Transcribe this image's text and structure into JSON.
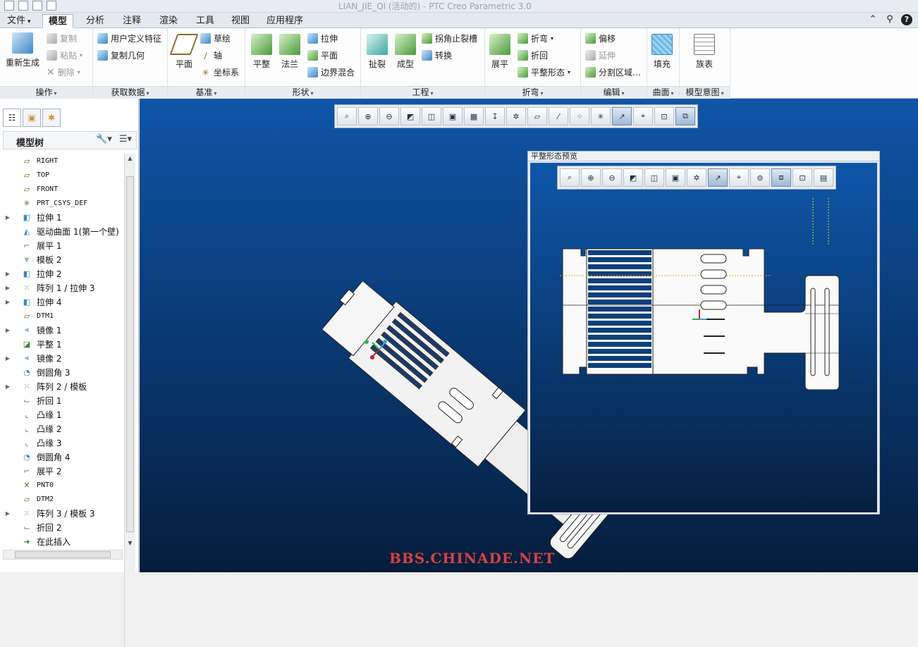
{
  "window": {
    "title": "LIAN_JIE_QI (活动的) - PTC Creo Parametric 3.0"
  },
  "tabs": [
    {
      "label": "文件",
      "dropdown": "▾"
    },
    {
      "label": "模型"
    },
    {
      "label": "分析"
    },
    {
      "label": "注释"
    },
    {
      "label": "渲染"
    },
    {
      "label": "工具"
    },
    {
      "label": "视图"
    },
    {
      "label": "应用程序"
    }
  ],
  "ribbon": {
    "ops": {
      "label": "操作",
      "regen": "重新生成",
      "copy": "复制",
      "paste": "粘贴",
      "delete": "删除"
    },
    "getdata": {
      "label": "获取数据",
      "udf": "用户定义特征",
      "copygeom": "复制几何"
    },
    "datum": {
      "label": "基准",
      "plane": "平面",
      "sketch": "草绘",
      "axis": "轴",
      "csys": "坐标系"
    },
    "shapes": {
      "label": "形状",
      "flat": "平整",
      "flange": "法兰",
      "extrude": "拉伸",
      "plane": "平面",
      "blend": "边界混合"
    },
    "eng": {
      "label": "工程",
      "rip": "扯裂",
      "form": "成型",
      "corner": "拐角止裂槽",
      "convert": "转换"
    },
    "bend": {
      "label": "折弯",
      "unfold": "展平",
      "bend": "折弯",
      "bendback": "折回",
      "flatstate": "平整形态"
    },
    "edit": {
      "label": "编辑",
      "offset": "偏移",
      "extend": "延伸",
      "split": "分割区域…"
    },
    "surface": {
      "label": "曲面",
      "fill": "填充"
    },
    "intent": {
      "label": "模型意图",
      "family": "族表"
    }
  },
  "model_tree": {
    "title": "模型树",
    "items": [
      {
        "label": "RIGHT",
        "icon": "datum-plane-icon",
        "expand": false,
        "mono": true
      },
      {
        "label": "TOP",
        "icon": "datum-plane-icon",
        "expand": false,
        "mono": true
      },
      {
        "label": "FRONT",
        "icon": "datum-plane-icon",
        "expand": false,
        "mono": true
      },
      {
        "label": "PRT_CSYS_DEF",
        "icon": "csys-icon",
        "expand": false,
        "mono": true
      },
      {
        "label": "拉伸 1",
        "icon": "extrude-icon",
        "expand": true
      },
      {
        "label": "驱动曲面 1(第一个壁)",
        "icon": "surface-icon",
        "expand": false
      },
      {
        "label": "展平 1",
        "icon": "unfold-icon",
        "expand": false
      },
      {
        "label": "模板 2",
        "icon": "form-icon",
        "expand": false
      },
      {
        "label": "拉伸 2",
        "icon": "extrude-icon",
        "expand": true
      },
      {
        "label": "阵列 1 / 拉伸 3",
        "icon": "pattern-icon",
        "expand": true
      },
      {
        "label": "拉伸 4",
        "icon": "extrude-icon",
        "expand": true
      },
      {
        "label": "DTM1",
        "icon": "datum-plane-icon",
        "expand": false,
        "mono": true
      },
      {
        "label": "镜像 1",
        "icon": "mirror-icon",
        "expand": true
      },
      {
        "label": "平整 1",
        "icon": "flat-icon",
        "expand": false
      },
      {
        "label": "镜像 2",
        "icon": "mirror-icon",
        "expand": true
      },
      {
        "label": "倒圆角 3",
        "icon": "round-icon",
        "expand": false
      },
      {
        "label": "阵列 2 / 模板",
        "icon": "pattern-icon",
        "expand": true
      },
      {
        "label": "折回 1",
        "icon": "bendback-icon",
        "expand": false
      },
      {
        "label": "凸缘 1",
        "icon": "flange-icon",
        "expand": false
      },
      {
        "label": "凸缘 2",
        "icon": "flange-icon",
        "expand": false
      },
      {
        "label": "凸缘 3",
        "icon": "flange-icon",
        "expand": false
      },
      {
        "label": "倒圆角 4",
        "icon": "round-icon",
        "expand": false
      },
      {
        "label": "展平 2",
        "icon": "unfold-icon",
        "expand": false
      },
      {
        "label": "PNT0",
        "icon": "point-icon",
        "expand": false,
        "mono": true
      },
      {
        "label": "DTM2",
        "icon": "datum-plane-icon",
        "expand": false,
        "mono": true
      },
      {
        "label": "阵列 3 / 模板 3",
        "icon": "pattern-icon",
        "expand": true
      },
      {
        "label": "折回 2",
        "icon": "bendback-icon",
        "expand": false
      },
      {
        "label": "在此插入",
        "icon": "insert-here-icon",
        "expand": false
      }
    ]
  },
  "preview": {
    "title": "平整形态预览"
  },
  "watermark": "BBS.CHINADE.NET",
  "colors": {
    "viewport_top": "#0f55a8",
    "viewport_bottom": "#051d3c",
    "accent": "#3a86c8"
  }
}
